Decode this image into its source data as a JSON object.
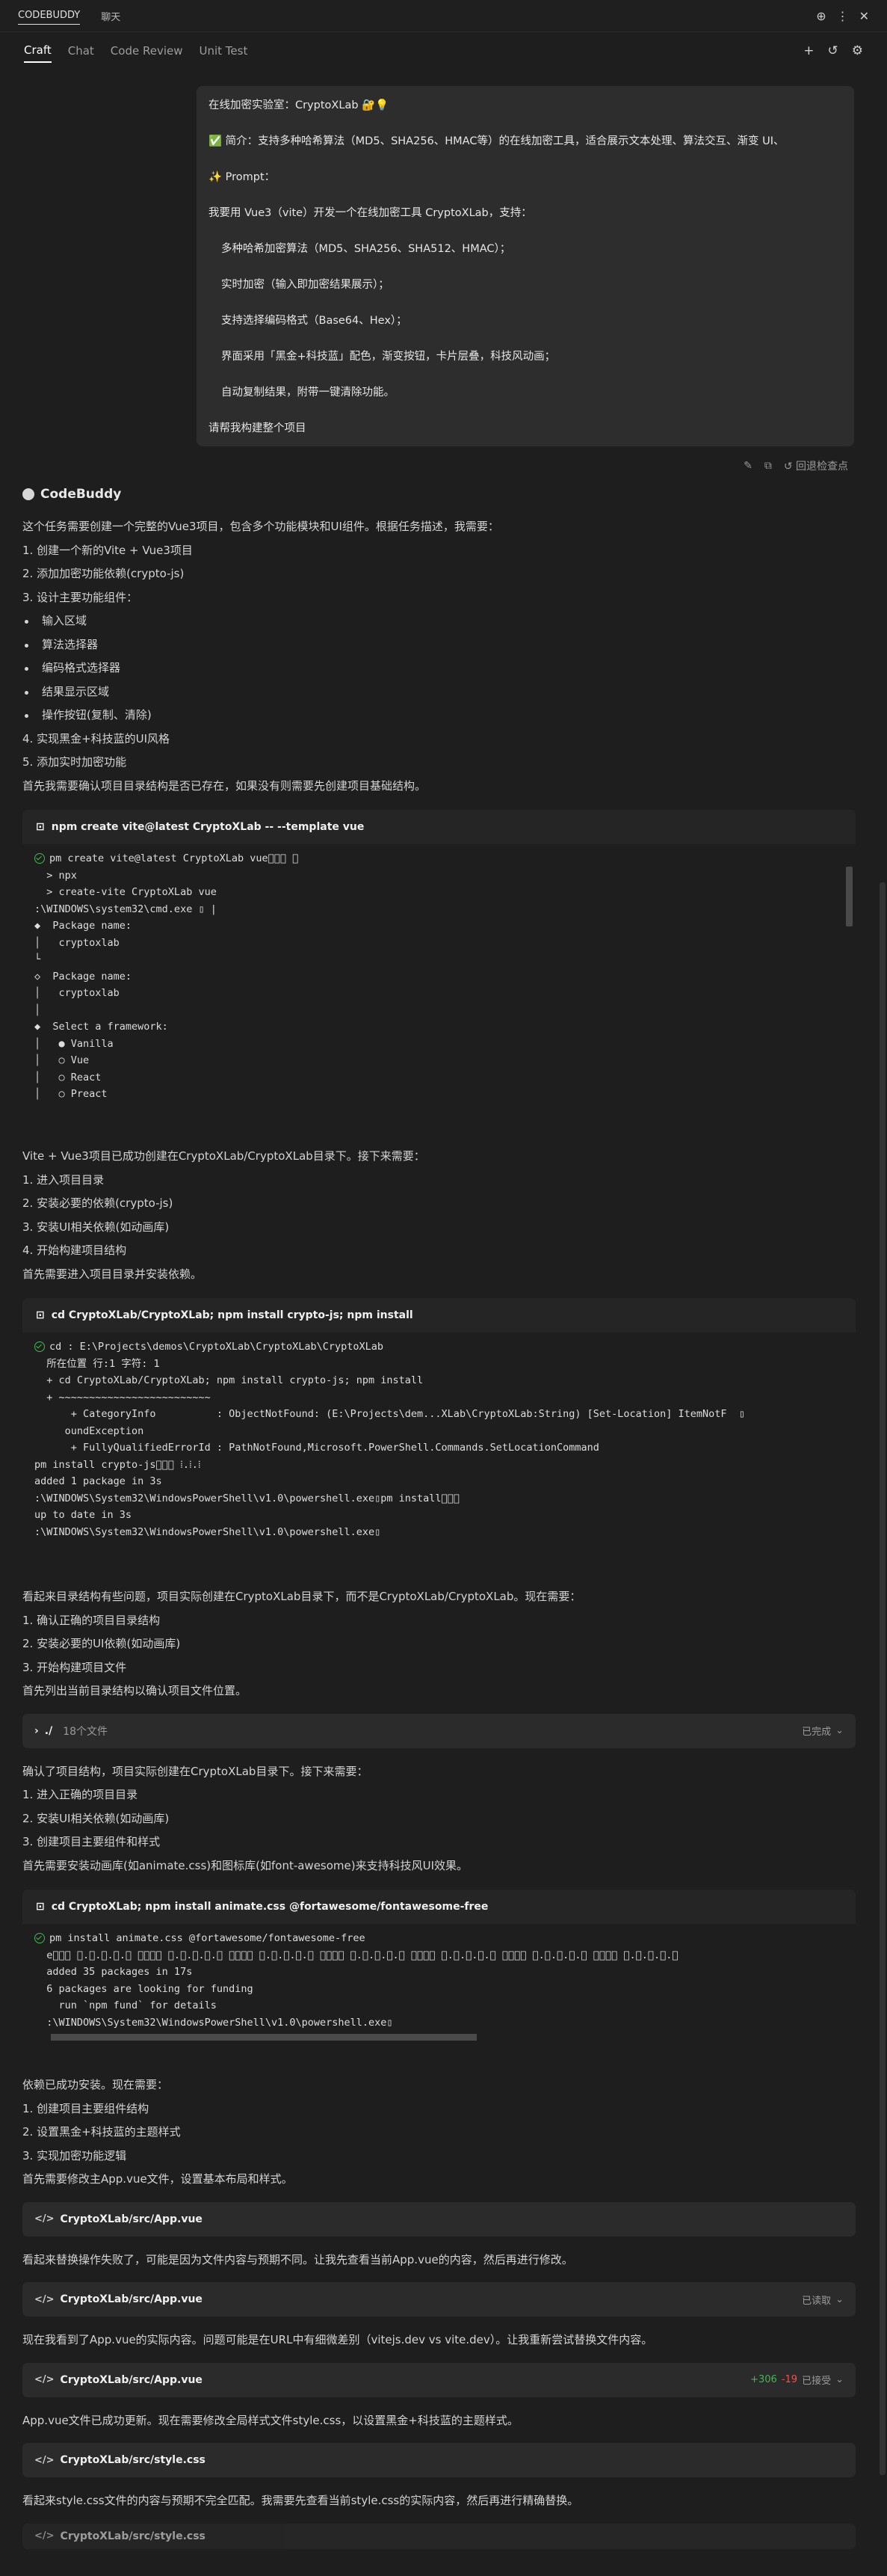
{
  "topbar": {
    "brand": "CODEBUDDY",
    "chat": "聊天"
  },
  "tabs": [
    "Craft",
    "Chat",
    "Code Review",
    "Unit Test"
  ],
  "prompt": {
    "lines": [
      "在线加密实验室：CryptoXLab 🔐💡",
      "✅ 简介：支持多种哈希算法（MD5、SHA256、HMAC等）的在线加密工具，适合展示文本处理、算法交互、渐变 UI、",
      "✨ Prompt：",
      "我要用 Vue3（vite）开发一个在线加密工具 CryptoXLab，支持：",
      "多种哈希加密算法（MD5、SHA256、SHA512、HMAC）；",
      "实时加密（输入即加密结果展示）；",
      "支持选择编码格式（Base64、Hex）；",
      "界面采用「黑金+科技蓝」配色，渐变按钮，卡片层叠，科技风动画；",
      "自动复制结果，附带一键清除功能。",
      "请帮我构建整个项目"
    ],
    "rollback": "回退检查点"
  },
  "assistant_name": "CodeBuddy",
  "p1": [
    "这个任务需要创建一个完整的Vue3项目，包含多个功能模块和UI组件。根据任务描述，我需要：",
    "1. 创建一个新的Vite + Vue3项目",
    "2. 添加加密功能依赖(crypto-js)",
    "3. 设计主要功能组件："
  ],
  "p1_bullets": [
    "输入区域",
    "算法选择器",
    "编码格式选择器",
    "结果显示区域",
    "操作按钮(复制、清除)"
  ],
  "p1_tail": [
    "4. 实现黑金+科技蓝的UI风格",
    "5. 添加实时加密功能",
    "首先我需要确认项目目录结构是否已存在，如果没有则需要先创建项目基础结构。"
  ],
  "term1": {
    "title": "npm create vite@latest CryptoXLab -- --template vue",
    "lines": [
      "pm create vite@latest CryptoXLab vue\u0000\u0000\u0000 ⁝",
      "  > npx",
      "  > create-vite CryptoXLab vue",
      "",
      ":\\WINDOWS\\system32\\cmd.exe ▯ |",
      "◆  Package name:",
      "│   cryptoxlab",
      "└",
      "◇  Package name:",
      "│   cryptoxlab",
      "│",
      "◆  Select a framework:",
      "│   ● Vanilla",
      "│   ○ Vue",
      "│   ○ React",
      "│   ○ Preact"
    ]
  },
  "p2": [
    "Vite + Vue3项目已成功创建在CryptoXLab/CryptoXLab目录下。接下来需要：",
    "1. 进入项目目录",
    "2. 安装必要的依赖(crypto-js)",
    "3. 安装UI相关依赖(如动画库)",
    "4. 开始构建项目结构",
    "首先需要进入项目目录并安装依赖。"
  ],
  "term2": {
    "title": "cd CryptoXLab/CryptoXLab; npm install crypto-js; npm install",
    "lines": [
      "cd : E:\\Projects\\demos\\CryptoXLab\\CryptoXLab\\CryptoXLab",
      "  所在位置 行:1 字符: 1",
      "  + cd CryptoXLab/CryptoXLab; npm install crypto-js; npm install",
      "  + ~~~~~~~~~~~~~~~~~~~~~~~~~",
      "      + CategoryInfo          : ObjectNotFound: (E:\\Projects\\dem...XLab\\CryptoXLab:String) [Set-Location] ItemNotF  ▯",
      "     oundException",
      "      + FullyQualifiedErrorId : PathNotFound,Microsoft.PowerShell.Commands.SetLocationCommand",
      "",
      "pm install crypto-js\u0000\u0000\u0000 ⁞.⁞.⁞",
      "added 1 package in 3s",
      ":\\WINDOWS\\System32\\WindowsPowerShell\\v1.0\\powershell.exe▯pm install\u0000\u0000\u0000",
      "up to date in 3s",
      ":\\WINDOWS\\System32\\WindowsPowerShell\\v1.0\\powershell.exe▯"
    ]
  },
  "p3": [
    "看起来目录结构有些问题，项目实际创建在CryptoXLab目录下，而不是CryptoXLab/CryptoXLab。现在需要：",
    "1. 确认正确的项目目录结构",
    "2. 安装必要的UI依赖(如动画库)",
    "3. 开始构建项目文件",
    "首先列出当前目录结构以确认项目文件位置。"
  ],
  "listdir": {
    "path": "./",
    "count": "18个文件",
    "status": "已完成"
  },
  "p4": [
    "确认了项目结构，项目实际创建在CryptoXLab目录下。接下来需要：",
    "1. 进入正确的项目目录",
    "2. 安装UI相关依赖(如动画库)",
    "3. 创建项目主要组件和样式",
    "首先需要安装动画库(如animate.css)和图标库(如font-awesome)来支持科技风UI效果。"
  ],
  "term3": {
    "title": "cd CryptoXLab; npm install animate.css @fortawesome/fontawesome-free",
    "lines": [
      "pm install animate.css @fortawesome/fontawesome-free",
      "  e\u0000\u0000\u0000 ⁝.⁝.⁝.⁝.⁝ ⁝\u0000\u0000\u0000 ⁝.⁝.⁝.⁝.⁝ ⁝\u0000\u0000\u0000 ⁝.⁝.⁝.⁝.⁝ ⁝\u0000\u0000\u0000 ⁝.⁝.⁝.⁝.⁝ ⁝\u0000\u0000\u0000 ⁝.⁝.⁝.⁝.⁝ ⁝\u0000\u0000\u0000 ⁝.⁝.⁝.⁝.⁝ ⁝\u0000\u0000\u0000 ⁝.⁝.⁝.⁝.⁝",
      "  added 35 packages in 17s",
      "",
      "  6 packages are looking for funding",
      "    run `npm fund` for details",
      "  :\\WINDOWS\\System32\\WindowsPowerShell\\v1.0\\powershell.exe▯"
    ]
  },
  "p5": [
    "依赖已成功安装。现在需要：",
    "1. 创建项目主要组件结构",
    "2. 设置黑金+科技蓝的主题样式",
    "3. 实现加密功能逻辑",
    "首先需要修改主App.vue文件，设置基本布局和样式。"
  ],
  "file1": {
    "name": "CryptoXLab/src/App.vue"
  },
  "p6": "看起来替换操作失败了，可能是因为文件内容与预期不同。让我先查看当前App.vue的内容，然后再进行修改。",
  "file2": {
    "name": "CryptoXLab/src/App.vue",
    "status": "已读取"
  },
  "p7": "现在我看到了App.vue的实际内容。问题可能是在URL中有细微差别（vitejs.dev vs vite.dev）。让我重新尝试替换文件内容。",
  "file3": {
    "name": "CryptoXLab/src/App.vue",
    "added": "+306",
    "removed": "-19",
    "status": "已接受"
  },
  "p8": "App.vue文件已成功更新。现在需要修改全局样式文件style.css，以设置黑金+科技蓝的主题样式。",
  "file4": {
    "name": "CryptoXLab/src/style.css"
  },
  "p9": "看起来style.css文件的内容与预期不完全匹配。我需要先查看当前style.css的实际内容，然后再进行精确替换。",
  "file5": {
    "name": "CryptoXLab/src/style.css"
  },
  "colors": {
    "bg": "#1e1e1e",
    "panel": "#252526",
    "success": "#3fb950",
    "danger": "#f85149"
  }
}
